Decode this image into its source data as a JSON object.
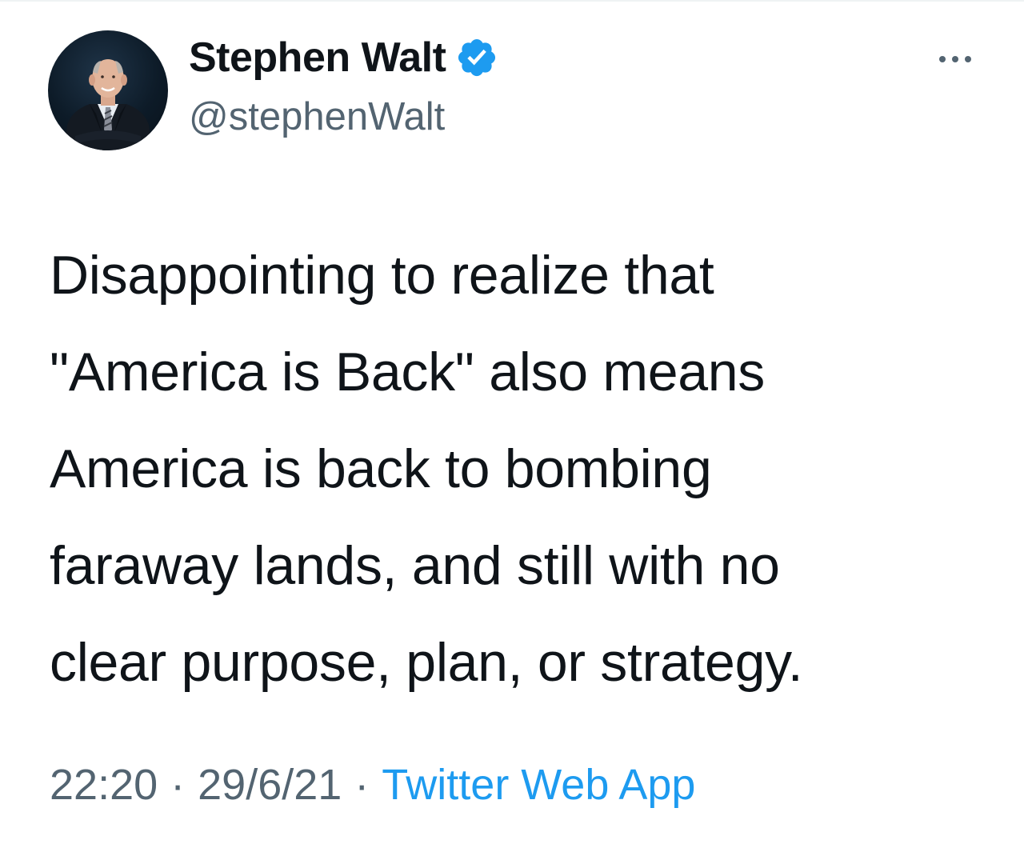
{
  "tweet": {
    "author": {
      "display_name": "Stephen Walt",
      "handle": "@stephenWalt",
      "verified": true,
      "avatar_icon": "profile-photo-icon",
      "verified_icon": "verified-badge-icon"
    },
    "more_icon": "more-options-icon",
    "text": "Disappointing to realize that\n\"America is Back\" also means\nAmerica is back to bombing\nfaraway lands,  and still with no\nclear purpose, plan, or strategy.",
    "meta": {
      "time": "22:20",
      "separator": "·",
      "date": "29/6/21",
      "source": "Twitter Web App"
    }
  },
  "colors": {
    "text_primary": "#0f1419",
    "text_secondary": "#536471",
    "accent": "#1d9bf0",
    "background": "#ffffff"
  }
}
